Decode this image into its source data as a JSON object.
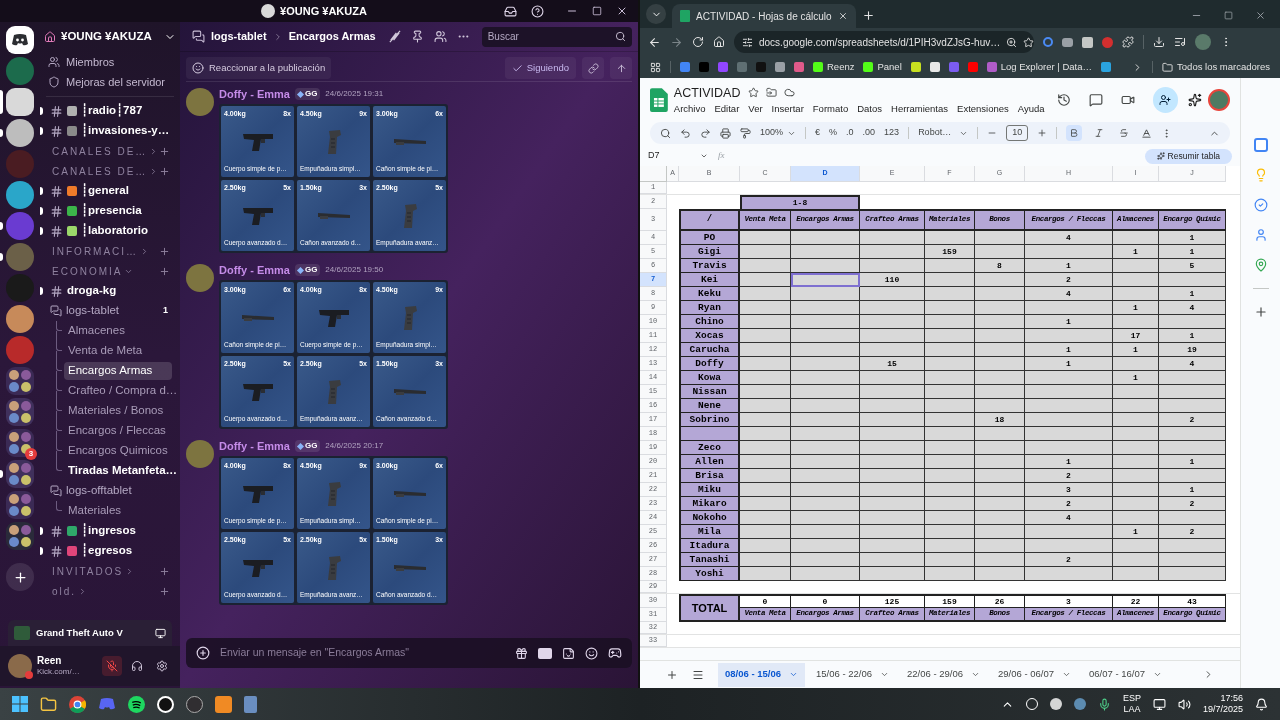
{
  "discord": {
    "title": "¥OUNG ¥AKUZA",
    "servers": [
      {
        "kind": "home",
        "selected": false,
        "unread": false
      },
      {
        "kind": "server",
        "selected": false,
        "unread": false,
        "color": "#1c6b4c"
      },
      {
        "kind": "server",
        "selected": true,
        "unread": false,
        "color": "#d9d9d9"
      },
      {
        "kind": "server",
        "selected": false,
        "unread": true,
        "color": "#bdbdbd"
      },
      {
        "kind": "server",
        "selected": false,
        "unread": false,
        "color": "#4a1c22"
      },
      {
        "kind": "server",
        "selected": false,
        "unread": false,
        "color": "#2aa6c9"
      },
      {
        "kind": "server",
        "selected": false,
        "unread": true,
        "color": "#6a3bd1"
      },
      {
        "kind": "server",
        "selected": false,
        "unread": true,
        "color": "#6b6048"
      },
      {
        "kind": "server",
        "selected": false,
        "unread": false,
        "color": "#1a1a1a"
      },
      {
        "kind": "server",
        "selected": false,
        "unread": false,
        "color": "#c78a5a"
      },
      {
        "kind": "server",
        "selected": false,
        "unread": false,
        "color": "#b82a2a"
      },
      {
        "kind": "folder",
        "selected": false,
        "unread": false,
        "color": "#3b2a55"
      },
      {
        "kind": "folder",
        "selected": false,
        "unread": false,
        "color": "#40305c"
      },
      {
        "kind": "folder",
        "selected": false,
        "unread": false,
        "color": "#3b2a55",
        "badge": "3"
      },
      {
        "kind": "folder",
        "selected": false,
        "unread": true,
        "color": "#40305c"
      },
      {
        "kind": "folder",
        "selected": false,
        "unread": false,
        "color": "#3b2a55"
      },
      {
        "kind": "folder",
        "selected": false,
        "unread": false,
        "color": "#2a2a3a"
      }
    ],
    "server_name": "¥OUNG ¥AKUZA",
    "links": [
      "Miembros",
      "Mejoras del servidor"
    ],
    "channels": [
      {
        "kind": "text",
        "name": "┊radio┊787",
        "unread": true,
        "color": "#b0b0b0"
      },
      {
        "kind": "text",
        "name": "┊invasiones-y…",
        "unread": true,
        "color": "#8a8a8a"
      },
      {
        "kind": "category",
        "name": "CANALES DE…",
        "expanded": false
      },
      {
        "kind": "category",
        "name": "CANALES DE…",
        "expanded": false
      },
      {
        "kind": "text",
        "name": "┊general",
        "unread": true,
        "color": "#f07b2a"
      },
      {
        "kind": "text",
        "name": "┊presencia",
        "unread": true,
        "color": "#3cb54a"
      },
      {
        "kind": "text",
        "name": "┊laboratorio",
        "unread": true,
        "color": "#9bd86a"
      },
      {
        "kind": "category",
        "name": "INFORMACI…",
        "expanded": false
      },
      {
        "kind": "category",
        "name": "ECONOMIA",
        "expanded": true
      },
      {
        "kind": "text",
        "name": "droga-kg",
        "unread": true
      },
      {
        "kind": "forum",
        "name": "logs-tablet",
        "count": "1",
        "children": [
          {
            "name": "Almacenes",
            "selected": false,
            "unread": false
          },
          {
            "name": "Venta de Meta",
            "selected": false,
            "unread": false
          },
          {
            "name": "Encargos Armas",
            "selected": true,
            "unread": false
          },
          {
            "name": "Crafteo / Compra d…",
            "selected": false,
            "unread": false
          },
          {
            "name": "Materiales / Bonos",
            "selected": false,
            "unread": false
          },
          {
            "name": "Encargos / Fleccas",
            "selected": false,
            "unread": false
          },
          {
            "name": "Encargos Quimicos",
            "selected": false,
            "unread": false
          },
          {
            "name": "Tiradas Metanfeta…",
            "selected": false,
            "unread": true
          }
        ]
      },
      {
        "kind": "forum",
        "name": "logs-offtablet",
        "children": [
          {
            "name": "Materiales",
            "selected": false,
            "unread": false
          }
        ]
      },
      {
        "kind": "text",
        "name": "┊ingresos",
        "unread": true,
        "color": "#2fa86a"
      },
      {
        "kind": "text",
        "name": "┊egresos",
        "unread": true,
        "color": "#e0457a"
      },
      {
        "kind": "category",
        "name": "INVITADOS",
        "expanded": false
      },
      {
        "kind": "category",
        "name": "old.",
        "expanded": false
      }
    ],
    "activity": "Grand Theft Auto V",
    "user": {
      "name": "Reen",
      "status": "Kick.com/…",
      "muted": true,
      "deafened": false
    },
    "breadcrumb": [
      "logs-tablet",
      "Encargos Armas"
    ],
    "search": {
      "placeholder": "Buscar"
    },
    "post_bar": {
      "react": "Reaccionar a la publicación",
      "follow": "Siguiendo",
      "following": true
    },
    "messages": [
      {
        "author": "Doffy - Emma",
        "tag": "GG",
        "time": "24/6/2025 19:31",
        "items": [
          {
            "weight": "4.00kg",
            "qty": "8x",
            "name": "Cuerpo simple de p…",
            "kind": "body"
          },
          {
            "weight": "4.50kg",
            "qty": "9x",
            "name": "Empuñadura simpl…",
            "kind": "grip"
          },
          {
            "weight": "3.00kg",
            "qty": "6x",
            "name": "Cañon simple de pi…",
            "kind": "barrel"
          },
          {
            "weight": "2.50kg",
            "qty": "5x",
            "name": "Cuerpo avanzado d…",
            "kind": "body"
          },
          {
            "weight": "1.50kg",
            "qty": "3x",
            "name": "Cañon avanzado d…",
            "kind": "barrel"
          },
          {
            "weight": "2.50kg",
            "qty": "5x",
            "name": "Empuñadura avanz…",
            "kind": "grip"
          }
        ]
      },
      {
        "author": "Doffy - Emma",
        "tag": "GG",
        "time": "24/6/2025 19:50",
        "items": [
          {
            "weight": "3.00kg",
            "qty": "6x",
            "name": "Cañon simple de pi…",
            "kind": "barrel"
          },
          {
            "weight": "4.00kg",
            "qty": "8x",
            "name": "Cuerpo simple de p…",
            "kind": "body"
          },
          {
            "weight": "4.50kg",
            "qty": "9x",
            "name": "Empuñadura simpl…",
            "kind": "grip"
          },
          {
            "weight": "2.50kg",
            "qty": "5x",
            "name": "Cuerpo avanzado d…",
            "kind": "body"
          },
          {
            "weight": "2.50kg",
            "qty": "5x",
            "name": "Empuñadura avanz…",
            "kind": "grip"
          },
          {
            "weight": "1.50kg",
            "qty": "3x",
            "name": "Cañon avanzado d…",
            "kind": "barrel"
          }
        ]
      },
      {
        "author": "Doffy - Emma",
        "tag": "GG",
        "time": "24/6/2025 20:17",
        "items": [
          {
            "weight": "4.00kg",
            "qty": "8x",
            "name": "Cuerpo simple de p…",
            "kind": "body"
          },
          {
            "weight": "4.50kg",
            "qty": "9x",
            "name": "Empuñadura simpl…",
            "kind": "grip"
          },
          {
            "weight": "3.00kg",
            "qty": "6x",
            "name": "Cañon simple de pi…",
            "kind": "barrel"
          },
          {
            "weight": "2.50kg",
            "qty": "5x",
            "name": "Cuerpo avanzado d…",
            "kind": "body"
          },
          {
            "weight": "2.50kg",
            "qty": "5x",
            "name": "Empuñadura avanz…",
            "kind": "grip"
          },
          {
            "weight": "1.50kg",
            "qty": "3x",
            "name": "Cañon avanzado d…",
            "kind": "barrel"
          }
        ]
      }
    ],
    "composer": {
      "placeholder": "Enviar un mensaje en \"Encargos Armas\""
    }
  },
  "browser": {
    "tab_title": "ACTIVIDAD - Hojas de cálculo",
    "url": "docs.google.com/spreadsheets/d/1PIH3vdZJsG-huv…",
    "bookmarks": [
      {
        "color": "#4285f4"
      },
      {
        "color": "#000000"
      },
      {
        "color": "#9146ff"
      },
      {
        "color": "#5f6f73"
      },
      {
        "color": "#111111"
      },
      {
        "color": "#9aa0a6"
      },
      {
        "color": "#e05a8a"
      },
      {
        "label": "Reenz",
        "color": "#53fc18"
      },
      {
        "label": "Panel",
        "color": "#53fc18"
      },
      {
        "color": "#c8e020"
      },
      {
        "color": "#e8e8e8"
      },
      {
        "color": "#7b5cf0"
      },
      {
        "color": "#ff0000"
      },
      {
        "label": "Log Explorer | Data…",
        "color": "#b05cc8"
      },
      {
        "color": "#2aa3df"
      }
    ],
    "all_bookmarks": "Todos los marcadores"
  },
  "sheet": {
    "title": "ACTIVIDAD",
    "menus": [
      "Archivo",
      "Editar",
      "Ver",
      "Insertar",
      "Formato",
      "Datos",
      "Herramientas",
      "Extensiones",
      "Ayuda"
    ],
    "toolbar": {
      "zoom": "100%",
      "currency": "€",
      "percent": "%",
      "decrease_decimals": ".0",
      "increase_decimals": ".00",
      "number_format": "123",
      "font": "Robot…",
      "font_size": "10",
      "bold": true,
      "italic": false,
      "strikethrough": false
    },
    "name_box": "D7",
    "formula_label": "fx",
    "summarize": "Resumir tabla",
    "grid": {
      "column_letters": [
        {
          "letter": "A",
          "selected": false
        },
        {
          "letter": "B",
          "selected": false
        },
        {
          "letter": "C",
          "selected": false
        },
        {
          "letter": "D",
          "selected": true
        },
        {
          "letter": "E",
          "selected": false
        },
        {
          "letter": "F",
          "selected": false
        },
        {
          "letter": "G",
          "selected": false
        },
        {
          "letter": "H",
          "selected": false
        },
        {
          "letter": "I",
          "selected": false
        },
        {
          "letter": "J",
          "selected": false
        }
      ],
      "rows": [
        {
          "kind": "blank",
          "n": "1",
          "selected": false
        },
        {
          "kind": "range",
          "n": "2",
          "label": "1-8",
          "selected": false
        },
        {
          "kind": "header",
          "n": "3",
          "corner": "/",
          "headers": [
            "Venta Meta",
            "Encargos Armas",
            "Crafteo Armas",
            "Materiales",
            "Bonos",
            "Encargos / Fleccas",
            "Almacenes",
            "Encargo Quimic"
          ],
          "selected": false
        },
        {
          "kind": "person",
          "n": "4",
          "name": "PO",
          "selected": false,
          "values": [
            {
              "kind": "empty"
            },
            {
              "kind": "empty"
            },
            {
              "kind": "empty"
            },
            {
              "kind": "empty"
            },
            {
              "kind": "empty"
            },
            {
              "kind": "number",
              "text": "4"
            },
            {
              "kind": "empty"
            },
            {
              "kind": "number",
              "text": "1"
            }
          ]
        },
        {
          "kind": "person",
          "n": "5",
          "name": "Gigi",
          "selected": false,
          "values": [
            {
              "kind": "empty"
            },
            {
              "kind": "empty"
            },
            {
              "kind": "empty"
            },
            {
              "kind": "number",
              "text": "159"
            },
            {
              "kind": "empty"
            },
            {
              "kind": "empty"
            },
            {
              "kind": "number",
              "text": "1"
            },
            {
              "kind": "number",
              "text": "1"
            }
          ]
        },
        {
          "kind": "person",
          "n": "6",
          "name": "Travis",
          "selected": false,
          "values": [
            {
              "kind": "empty"
            },
            {
              "kind": "empty"
            },
            {
              "kind": "empty"
            },
            {
              "kind": "empty"
            },
            {
              "kind": "number",
              "text": "8"
            },
            {
              "kind": "number",
              "text": "1"
            },
            {
              "kind": "empty"
            },
            {
              "kind": "number",
              "text": "5"
            }
          ]
        },
        {
          "kind": "person",
          "n": "7",
          "name": "Kei",
          "selected": true,
          "values": [
            {
              "kind": "empty"
            },
            {
              "kind": "empty"
            },
            {
              "kind": "number",
              "text": "110"
            },
            {
              "kind": "empty"
            },
            {
              "kind": "empty"
            },
            {
              "kind": "number",
              "text": "2"
            },
            {
              "kind": "empty"
            },
            {
              "kind": "empty"
            }
          ]
        },
        {
          "kind": "person",
          "n": "8",
          "name": "Keku",
          "selected": false,
          "values": [
            {
              "kind": "empty"
            },
            {
              "kind": "empty"
            },
            {
              "kind": "empty"
            },
            {
              "kind": "empty"
            },
            {
              "kind": "empty"
            },
            {
              "kind": "number",
              "text": "4"
            },
            {
              "kind": "empty"
            },
            {
              "kind": "number",
              "text": "1"
            }
          ]
        },
        {
          "kind": "person",
          "n": "9",
          "name": "Ryan",
          "selected": false,
          "values": [
            {
              "kind": "empty"
            },
            {
              "kind": "empty"
            },
            {
              "kind": "empty"
            },
            {
              "kind": "empty"
            },
            {
              "kind": "empty"
            },
            {
              "kind": "empty"
            },
            {
              "kind": "number",
              "text": "1"
            },
            {
              "kind": "number",
              "text": "4"
            }
          ]
        },
        {
          "kind": "person",
          "n": "10",
          "name": "Chino",
          "selected": false,
          "values": [
            {
              "kind": "empty"
            },
            {
              "kind": "empty"
            },
            {
              "kind": "empty"
            },
            {
              "kind": "empty"
            },
            {
              "kind": "empty"
            },
            {
              "kind": "number",
              "text": "1"
            },
            {
              "kind": "empty"
            },
            {
              "kind": "empty"
            }
          ]
        },
        {
          "kind": "person",
          "n": "11",
          "name": "Xocas",
          "selected": false,
          "values": [
            {
              "kind": "empty"
            },
            {
              "kind": "empty"
            },
            {
              "kind": "empty"
            },
            {
              "kind": "empty"
            },
            {
              "kind": "empty"
            },
            {
              "kind": "empty"
            },
            {
              "kind": "number",
              "text": "17"
            },
            {
              "kind": "number",
              "text": "1"
            }
          ]
        },
        {
          "kind": "person",
          "n": "12",
          "name": "Carucha",
          "selected": false,
          "values": [
            {
              "kind": "empty"
            },
            {
              "kind": "empty"
            },
            {
              "kind": "empty"
            },
            {
              "kind": "empty"
            },
            {
              "kind": "empty"
            },
            {
              "kind": "number",
              "text": "1"
            },
            {
              "kind": "number",
              "text": "1"
            },
            {
              "kind": "number",
              "text": "19"
            }
          ]
        },
        {
          "kind": "person",
          "n": "13",
          "name": "Doffy",
          "selected": false,
          "values": [
            {
              "kind": "empty"
            },
            {
              "kind": "empty"
            },
            {
              "kind": "number",
              "text": "15"
            },
            {
              "kind": "empty"
            },
            {
              "kind": "empty"
            },
            {
              "kind": "number",
              "text": "1"
            },
            {
              "kind": "empty"
            },
            {
              "kind": "number",
              "text": "4"
            }
          ]
        },
        {
          "kind": "person",
          "n": "14",
          "name": "Kowa",
          "selected": false,
          "values": [
            {
              "kind": "empty"
            },
            {
              "kind": "empty"
            },
            {
              "kind": "empty"
            },
            {
              "kind": "empty"
            },
            {
              "kind": "empty"
            },
            {
              "kind": "empty"
            },
            {
              "kind": "number",
              "text": "1"
            },
            {
              "kind": "empty"
            }
          ]
        },
        {
          "kind": "person",
          "n": "15",
          "name": "Nissan",
          "selected": false,
          "values": [
            {
              "kind": "empty"
            },
            {
              "kind": "empty"
            },
            {
              "kind": "empty"
            },
            {
              "kind": "empty"
            },
            {
              "kind": "empty"
            },
            {
              "kind": "empty"
            },
            {
              "kind": "empty"
            },
            {
              "kind": "empty"
            }
          ]
        },
        {
          "kind": "person",
          "n": "16",
          "name": "Nene",
          "selected": false,
          "values": [
            {
              "kind": "empty"
            },
            {
              "kind": "empty"
            },
            {
              "kind": "empty"
            },
            {
              "kind": "empty"
            },
            {
              "kind": "empty"
            },
            {
              "kind": "empty"
            },
            {
              "kind": "empty"
            },
            {
              "kind": "empty"
            }
          ]
        },
        {
          "kind": "person",
          "n": "17",
          "name": "Sobrino",
          "selected": false,
          "values": [
            {
              "kind": "empty"
            },
            {
              "kind": "empty"
            },
            {
              "kind": "empty"
            },
            {
              "kind": "empty"
            },
            {
              "kind": "number",
              "text": "18"
            },
            {
              "kind": "empty"
            },
            {
              "kind": "empty"
            },
            {
              "kind": "number",
              "text": "2"
            }
          ]
        },
        {
          "kind": "person",
          "n": "18",
          "selected": false,
          "values": [
            {
              "kind": "empty"
            },
            {
              "kind": "empty"
            },
            {
              "kind": "empty"
            },
            {
              "kind": "empty"
            },
            {
              "kind": "empty"
            },
            {
              "kind": "empty"
            },
            {
              "kind": "empty"
            },
            {
              "kind": "empty"
            }
          ]
        },
        {
          "kind": "person",
          "n": "19",
          "name": "Zeco",
          "selected": false,
          "values": [
            {
              "kind": "empty"
            },
            {
              "kind": "empty"
            },
            {
              "kind": "empty"
            },
            {
              "kind": "empty"
            },
            {
              "kind": "empty"
            },
            {
              "kind": "empty"
            },
            {
              "kind": "empty"
            },
            {
              "kind": "empty"
            }
          ]
        },
        {
          "kind": "person",
          "n": "20",
          "name": "Allen",
          "selected": false,
          "values": [
            {
              "kind": "empty"
            },
            {
              "kind": "empty"
            },
            {
              "kind": "empty"
            },
            {
              "kind": "empty"
            },
            {
              "kind": "empty"
            },
            {
              "kind": "number",
              "text": "1"
            },
            {
              "kind": "empty"
            },
            {
              "kind": "number",
              "text": "1"
            }
          ]
        },
        {
          "kind": "person",
          "n": "21",
          "name": "Brisa",
          "selected": false,
          "values": [
            {
              "kind": "empty"
            },
            {
              "kind": "empty"
            },
            {
              "kind": "empty"
            },
            {
              "kind": "empty"
            },
            {
              "kind": "empty"
            },
            {
              "kind": "number",
              "text": "2"
            },
            {
              "kind": "empty"
            },
            {
              "kind": "empty"
            }
          ]
        },
        {
          "kind": "person",
          "n": "22",
          "name": "Miku",
          "selected": false,
          "values": [
            {
              "kind": "empty"
            },
            {
              "kind": "empty"
            },
            {
              "kind": "empty"
            },
            {
              "kind": "empty"
            },
            {
              "kind": "empty"
            },
            {
              "kind": "number",
              "text": "3"
            },
            {
              "kind": "empty"
            },
            {
              "kind": "number",
              "text": "1"
            }
          ]
        },
        {
          "kind": "person",
          "n": "23",
          "name": "Mikaro",
          "selected": false,
          "values": [
            {
              "kind": "empty"
            },
            {
              "kind": "empty"
            },
            {
              "kind": "empty"
            },
            {
              "kind": "empty"
            },
            {
              "kind": "empty"
            },
            {
              "kind": "number",
              "text": "2"
            },
            {
              "kind": "empty"
            },
            {
              "kind": "number",
              "text": "2"
            }
          ]
        },
        {
          "kind": "person",
          "n": "24",
          "name": "Nokoho",
          "selected": false,
          "values": [
            {
              "kind": "empty"
            },
            {
              "kind": "empty"
            },
            {
              "kind": "empty"
            },
            {
              "kind": "empty"
            },
            {
              "kind": "empty"
            },
            {
              "kind": "number",
              "text": "4"
            },
            {
              "kind": "empty"
            },
            {
              "kind": "empty"
            }
          ]
        },
        {
          "kind": "person",
          "n": "25",
          "name": "Mila",
          "selected": false,
          "values": [
            {
              "kind": "empty"
            },
            {
              "kind": "empty"
            },
            {
              "kind": "empty"
            },
            {
              "kind": "empty"
            },
            {
              "kind": "empty"
            },
            {
              "kind": "empty"
            },
            {
              "kind": "number",
              "text": "1"
            },
            {
              "kind": "number",
              "text": "2"
            }
          ]
        },
        {
          "kind": "person",
          "n": "26",
          "name": "Itadura",
          "selected": false,
          "values": [
            {
              "kind": "empty"
            },
            {
              "kind": "empty"
            },
            {
              "kind": "empty"
            },
            {
              "kind": "empty"
            },
            {
              "kind": "empty"
            },
            {
              "kind": "empty"
            },
            {
              "kind": "empty"
            },
            {
              "kind": "empty"
            }
          ]
        },
        {
          "kind": "person",
          "n": "27",
          "name": "Tanashi",
          "selected": false,
          "values": [
            {
              "kind": "empty"
            },
            {
              "kind": "empty"
            },
            {
              "kind": "empty"
            },
            {
              "kind": "empty"
            },
            {
              "kind": "empty"
            },
            {
              "kind": "number",
              "text": "2"
            },
            {
              "kind": "empty"
            },
            {
              "kind": "empty"
            }
          ]
        },
        {
          "kind": "person",
          "n": "28",
          "name": "Yoshi",
          "selected": false,
          "values": [
            {
              "kind": "empty"
            },
            {
              "kind": "empty"
            },
            {
              "kind": "empty"
            },
            {
              "kind": "empty"
            },
            {
              "kind": "empty"
            },
            {
              "kind": "empty"
            },
            {
              "kind": "empty"
            },
            {
              "kind": "empty"
            }
          ]
        },
        {
          "kind": "blank",
          "n": "29",
          "selected": false
        },
        {
          "kind": "total",
          "numbers": [
            "30",
            "31"
          ],
          "label": "TOTAL",
          "values": [
            "0",
            "0",
            "125",
            "159",
            "26",
            "3",
            "22",
            "43"
          ],
          "captions": [
            "Venta Meta",
            "Encargos Armas",
            "Crafteo Armas",
            "Materiales",
            "Bonos",
            "Encargos / Fleccas",
            "Almacenes",
            "Encargo Quimic"
          ],
          "selected": false
        },
        {
          "kind": "blank",
          "n": "32",
          "selected": false
        },
        {
          "kind": "blank",
          "n": "33",
          "selected": false
        }
      ]
    },
    "tabs": [
      {
        "label": "08/06 - 15/06",
        "selected": true
      },
      {
        "label": "15/06 - 22/06",
        "selected": false
      },
      {
        "label": "22/06 - 29/06",
        "selected": false
      },
      {
        "label": "29/06 - 06/07",
        "selected": false
      },
      {
        "label": "06/07 - 16/07",
        "selected": false
      }
    ]
  },
  "taskbar": {
    "language": [
      "ESP",
      "LAA"
    ],
    "time": "17:56",
    "date": "19/7/2025"
  }
}
